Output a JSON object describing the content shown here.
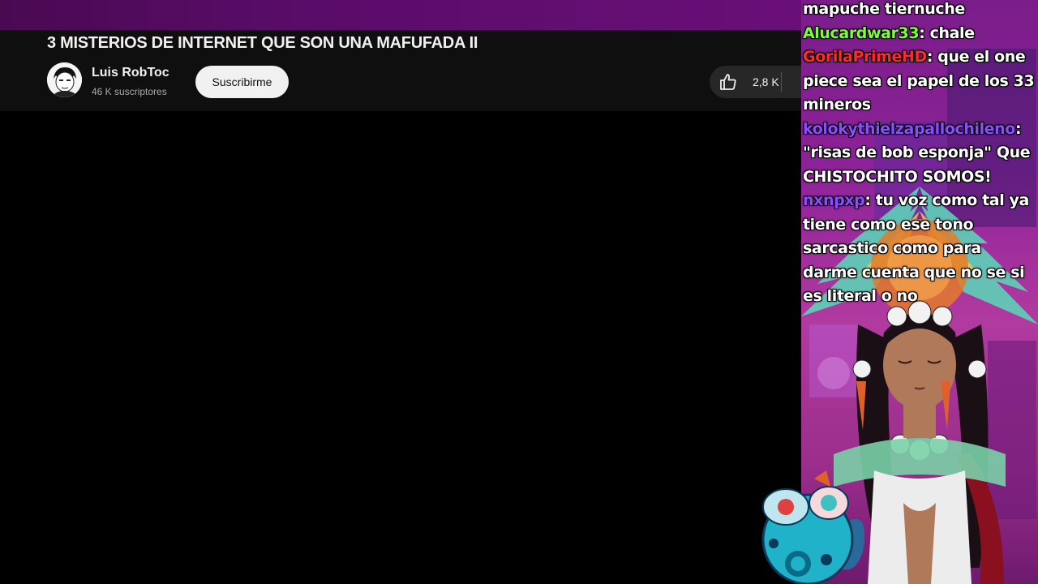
{
  "video": {
    "title": "3 MISTERIOS DE INTERNET QUE SON UNA MAFUFADA II",
    "channel_name": "Luis RobToc",
    "subscribers": "46 K suscriptores",
    "subscribe_label": "Suscribirme",
    "like_count": "2,8 K"
  },
  "chat": {
    "messages": [
      {
        "user": "",
        "text": "mapuche tiernuche",
        "color": "#ffffff"
      },
      {
        "user": "Alucardwar33",
        "text": ": chale",
        "color": "#7cff3a"
      },
      {
        "user": "GorilaPrimeHD",
        "text": ": que el one piece sea el papel de los 33 mineros",
        "color": "#ff2a2a"
      },
      {
        "user": "kolokythielzapallochileno",
        "text": ": \"risas de bob esponja\" Que CHISTOCHITO SOMOS!",
        "color": "#8a4dff"
      },
      {
        "user": "nxnpxp",
        "text": ": tu voz como tal ya tiene como ese tono sarcastico como para darme cuenta que no se si es literal o no",
        "color": "#8a4dff"
      }
    ]
  },
  "colors": {
    "youtube_bg": "#0f0f0f",
    "overlay_purple": "#8e2399"
  },
  "icons": [
    "like-icon",
    "avatar",
    "streamer-avatar",
    "mascot"
  ]
}
